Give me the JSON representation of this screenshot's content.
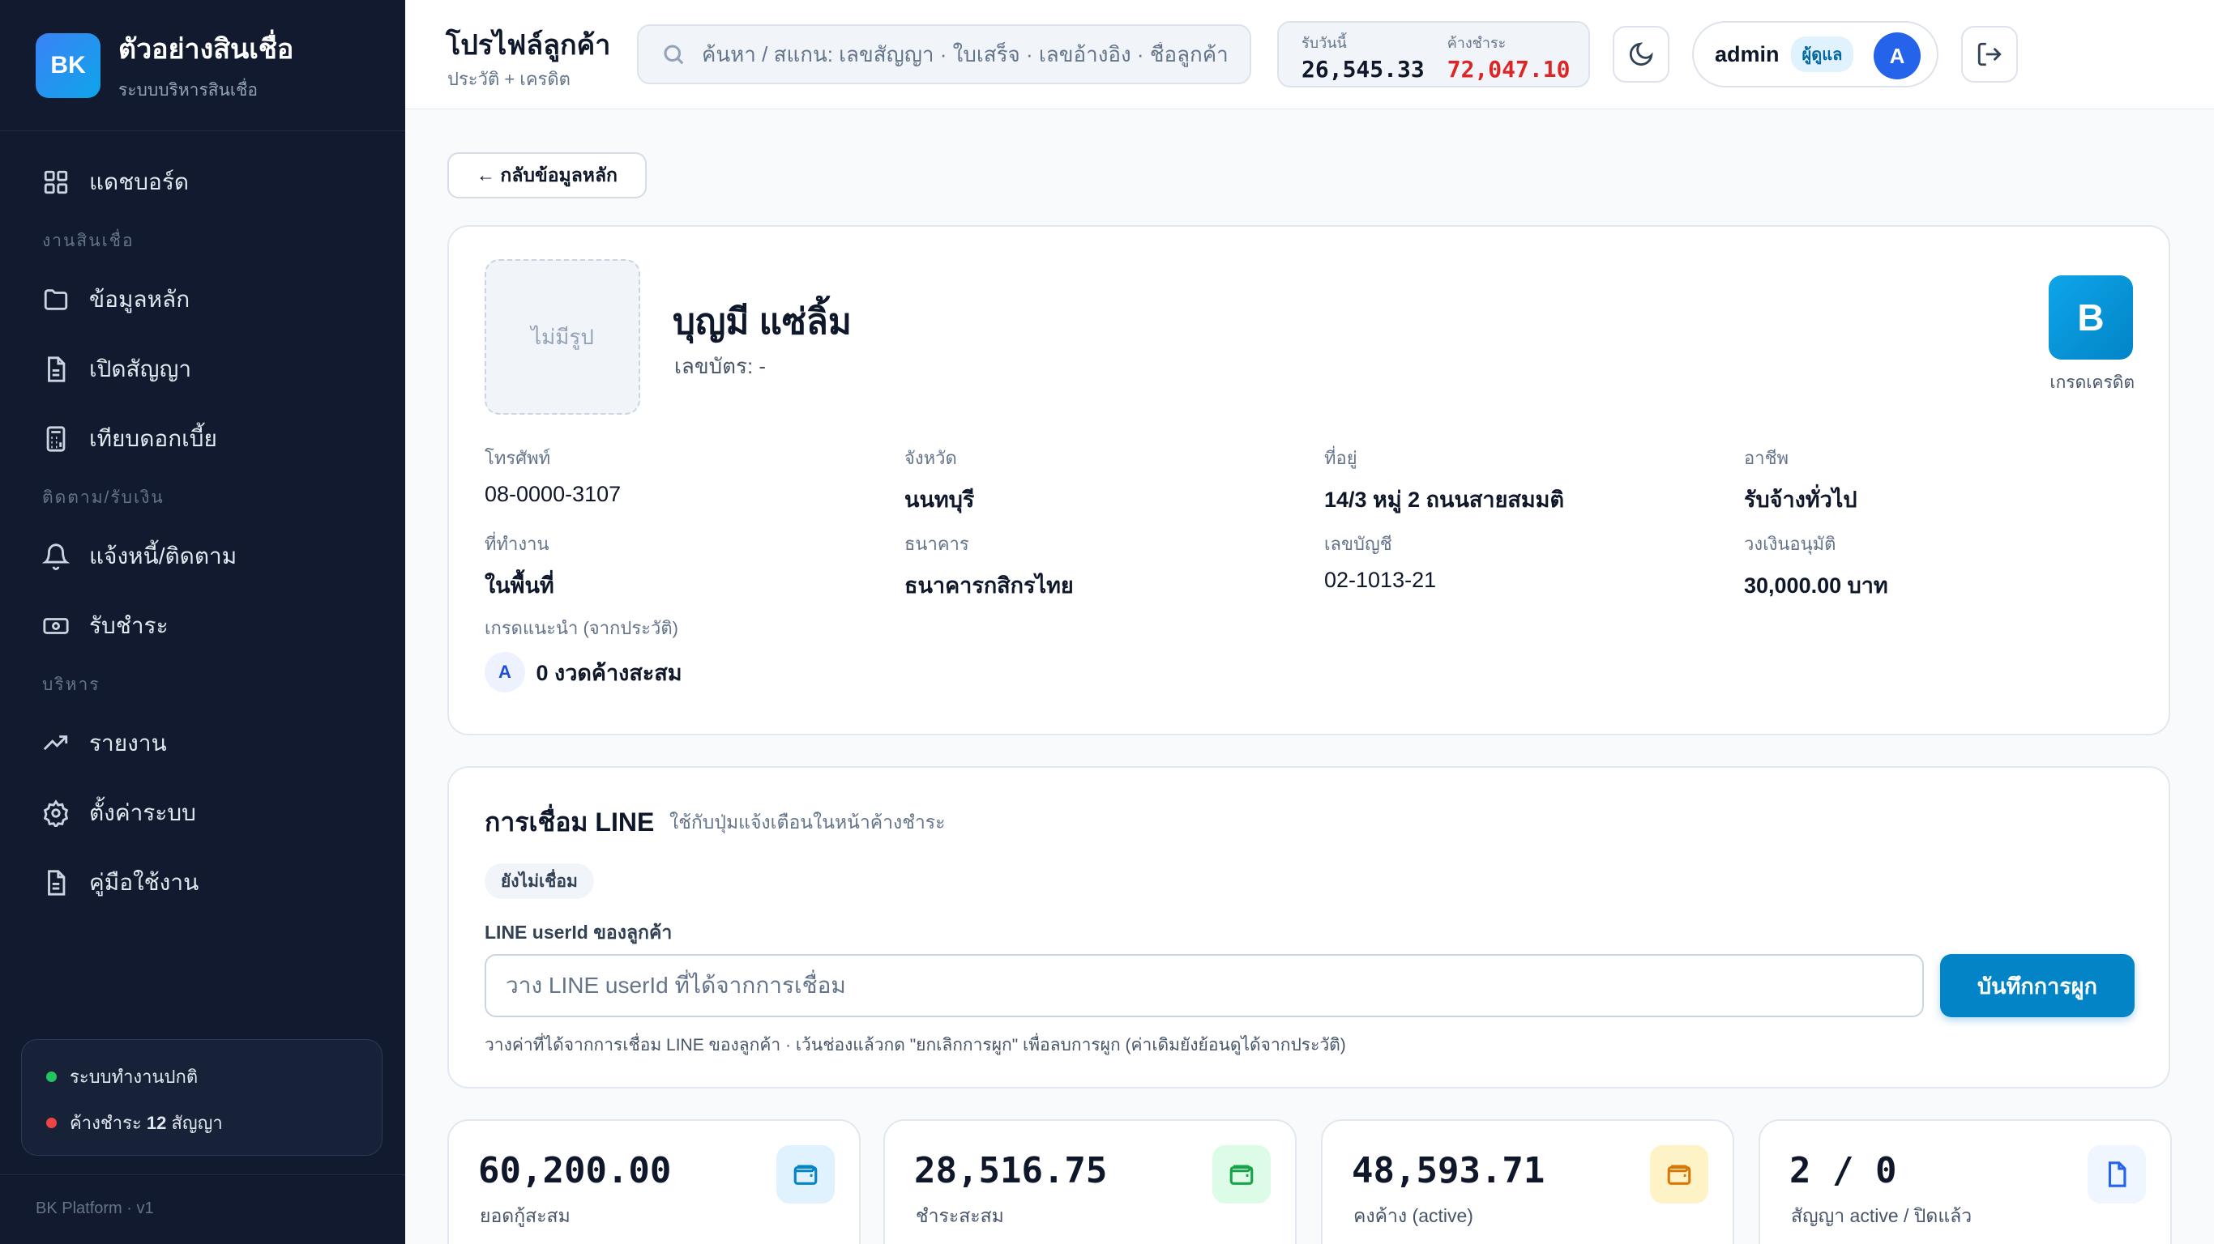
{
  "brand": {
    "logo": "BK",
    "title": "ตัวอย่างสินเชื่อ",
    "subtitle": "ระบบบริหารสินเชื่อ"
  },
  "nav": {
    "dashboard": "แดชบอร์ด",
    "section_loans": "งานสินเชื่อ",
    "master": "ข้อมูลหลัก",
    "open_contract": "เปิดสัญญา",
    "compare_interest": "เทียบดอกเบี้ย",
    "section_collect": "ติดตาม/รับเงิน",
    "notify": "แจ้งหนี้/ติดตาม",
    "receive": "รับชำระ",
    "section_admin": "บริหาร",
    "reports": "รายงาน",
    "settings": "ตั้งค่าระบบ",
    "manual": "คู่มือใช้งาน"
  },
  "status_box": {
    "system_ok": "ระบบทำงานปกติ",
    "overdue_prefix": "ค้างชำระ",
    "overdue_count": "12",
    "overdue_suffix": "สัญญา",
    "ok_color": "#22c55e",
    "overdue_color": "#ef4444"
  },
  "sidebar_footer": "BK Platform · v1",
  "header": {
    "title": "โปรไฟล์ลูกค้า",
    "subtitle": "ประวัติ + เครดิต",
    "search_placeholder": "ค้นหา / สแกน: เลขสัญญา · ใบเสร็จ · เลขอ้างอิง · ชื่อลูกค้า",
    "received_today_label": "รับวันนี้",
    "received_today": "26,545.33",
    "overdue_label": "ค้างชำระ",
    "overdue_amount": "72,047.10",
    "user": "admin",
    "role": "ผู้ดูแล",
    "avatar": "A"
  },
  "back_label": "← กลับข้อมูลหลัก",
  "profile": {
    "photo_placeholder": "ไม่มีรูป",
    "name": "บุญมี แซ่ลิ้ม",
    "id_card": "เลขบัตร: -",
    "grade": "B",
    "grade_label": "เกรดเครดิต",
    "fields": [
      {
        "label": "โทรศัพท์",
        "value": "08-0000-3107"
      },
      {
        "label": "จังหวัด",
        "value": "นนทบุรี"
      },
      {
        "label": "ที่อยู่",
        "value": "14/3 หมู่ 2 ถนนสายสมมติ"
      },
      {
        "label": "อาชีพ",
        "value": "รับจ้างทั่วไป"
      },
      {
        "label": "ที่ทำงาน",
        "value": "ในพื้นที่"
      },
      {
        "label": "ธนาคาร",
        "value": "ธนาคารกสิกรไทย"
      },
      {
        "label": "เลขบัญชี",
        "value": "02-1013-21"
      },
      {
        "label": "วงเงินอนุมัติ",
        "value": "30,000.00 บาท"
      }
    ],
    "reco_label": "เกรดแนะนำ (จากประวัติ)",
    "reco_grade": "A",
    "reco_text": "0 งวดค้างสะสม"
  },
  "line": {
    "title": "การเชื่อม LINE",
    "subtitle": "ใช้กับปุ่มแจ้งเตือนในหน้าค้างชำระ",
    "status": "ยังไม่เชื่อม",
    "field_label": "LINE userId ของลูกค้า",
    "placeholder": "วาง LINE userId ที่ได้จากการเชื่อม",
    "save": "บันทึกการผูก",
    "help": "วางค่าที่ได้จากการเชื่อม LINE ของลูกค้า · เว้นช่องแล้วกด \"ยกเลิกการผูก\" เพื่อลบการผูก (ค่าเดิมยังย้อนดูได้จากประวัติ)"
  },
  "stats": [
    {
      "value": "60,200.00",
      "label": "ยอดกู้สะสม",
      "icon": "wallet-icon",
      "bg": "#e0f2fe",
      "color": "#0284c7"
    },
    {
      "value": "28,516.75",
      "label": "ชำระสะสม",
      "icon": "wallet-icon",
      "bg": "#dcfce7",
      "color": "#16a34a"
    },
    {
      "value": "48,593.71",
      "label": "คงค้าง (active)",
      "icon": "wallet-icon",
      "bg": "#fef3c7",
      "color": "#d97706"
    },
    {
      "value": "2 / 0",
      "label": "สัญญา active / ปิดแล้ว",
      "icon": "document-icon",
      "bg": "#eff6ff",
      "color": "#2563eb"
    }
  ]
}
